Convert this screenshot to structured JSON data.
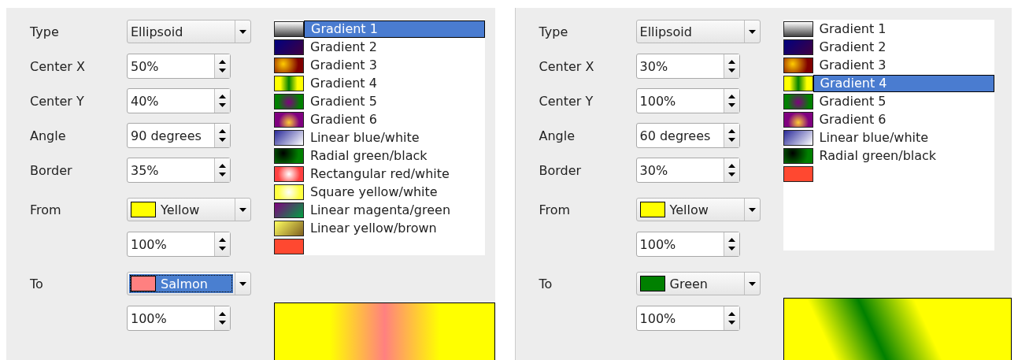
{
  "panels": [
    {
      "fields": [
        {
          "kind": "dropdown",
          "label": "Type",
          "value": "Ellipsoid",
          "focused": false
        },
        {
          "kind": "spin",
          "label": "Center X",
          "value": "50%"
        },
        {
          "kind": "spin",
          "label": "Center Y",
          "value": "40%"
        },
        {
          "kind": "spin",
          "label": "Angle",
          "value": "90 degrees"
        },
        {
          "kind": "spin",
          "label": "Border",
          "value": "35%"
        },
        {
          "kind": "color-dropdown",
          "label": "From",
          "value": "Yellow",
          "color": "#ffff00",
          "focused": false
        },
        {
          "kind": "spin",
          "value": "100%"
        },
        {
          "kind": "color-dropdown",
          "label": "To",
          "value": "Salmon",
          "color": "#ff8080",
          "focused": true
        },
        {
          "kind": "spin",
          "value": "100%"
        }
      ],
      "gradients": [
        {
          "label": "Gradient 1",
          "selected": true
        },
        {
          "label": "Gradient 2",
          "selected": false
        },
        {
          "label": "Gradient 3",
          "selected": false
        },
        {
          "label": "Gradient 4",
          "selected": false
        },
        {
          "label": "Gradient 5",
          "selected": false
        },
        {
          "label": "Gradient 6",
          "selected": false
        },
        {
          "label": "Linear blue/white",
          "selected": false
        },
        {
          "label": "Radial green/black",
          "selected": false
        },
        {
          "label": "Rectangular red/white",
          "selected": false
        },
        {
          "label": "Square yellow/white",
          "selected": false
        },
        {
          "label": "Linear magenta/green",
          "selected": false
        },
        {
          "label": "Linear yellow/brown",
          "selected": false
        },
        {
          "selected": false
        }
      ],
      "preview": {
        "kind": "vertical-band"
      }
    },
    {
      "fields": [
        {
          "kind": "dropdown",
          "label": "Type",
          "value": "Ellipsoid",
          "focused": false
        },
        {
          "kind": "spin",
          "label": "Center X",
          "value": "30%"
        },
        {
          "kind": "spin",
          "label": "Center Y",
          "value": "100%"
        },
        {
          "kind": "spin",
          "label": "Angle",
          "value": "60 degrees"
        },
        {
          "kind": "spin",
          "label": "Border",
          "value": "30%"
        },
        {
          "kind": "color-dropdown",
          "label": "From",
          "value": "Yellow",
          "color": "#ffff00",
          "focused": false
        },
        {
          "kind": "spin",
          "value": "100%"
        },
        {
          "kind": "color-dropdown",
          "label": "To",
          "value": "Green",
          "color": "#008000",
          "focused": false
        },
        {
          "kind": "spin",
          "value": "100%"
        }
      ],
      "gradients": [
        {
          "label": "Gradient 1",
          "selected": false
        },
        {
          "label": "Gradient 2",
          "selected": false
        },
        {
          "label": "Gradient 3",
          "selected": false
        },
        {
          "label": "Gradient 4",
          "selected": true
        },
        {
          "label": "Gradient 5",
          "selected": false
        },
        {
          "label": "Gradient 6",
          "selected": false
        },
        {
          "label": "Linear blue/white",
          "selected": false
        },
        {
          "label": "Radial green/black",
          "selected": false
        },
        {
          "selected": false
        }
      ],
      "preview": {
        "kind": "diagonal-band"
      }
    }
  ]
}
